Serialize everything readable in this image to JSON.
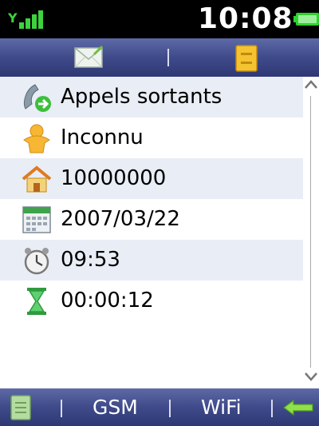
{
  "status": {
    "signal_icon": "signal-bars-icon",
    "time": "10:08",
    "battery_icon": "battery-icon"
  },
  "tabs": [
    {
      "icon": "envelope-icon",
      "selected": false
    },
    {
      "icon": "contact-card-icon",
      "selected": true
    }
  ],
  "details": [
    {
      "icon": "phone-outgoing-icon",
      "text": "Appels sortants"
    },
    {
      "icon": "person-icon",
      "text": "Inconnu"
    },
    {
      "icon": "home-icon",
      "text": "10000000"
    },
    {
      "icon": "calendar-icon",
      "text": "2007/03/22"
    },
    {
      "icon": "alarm-clock-icon",
      "text": "09:53"
    },
    {
      "icon": "hourglass-icon",
      "text": "00:00:12"
    }
  ],
  "bottom_bar": {
    "menu_icon": "document-icon",
    "gsm_label": "GSM",
    "wifi_label": "WiFi",
    "back_icon": "back-arrow-icon"
  },
  "colors": {
    "bar_gradient_top": "#5e6aa6",
    "bar_gradient_bottom": "#2e3874",
    "row_shade": "#e9edf5",
    "accent_green": "#2fd12f"
  }
}
